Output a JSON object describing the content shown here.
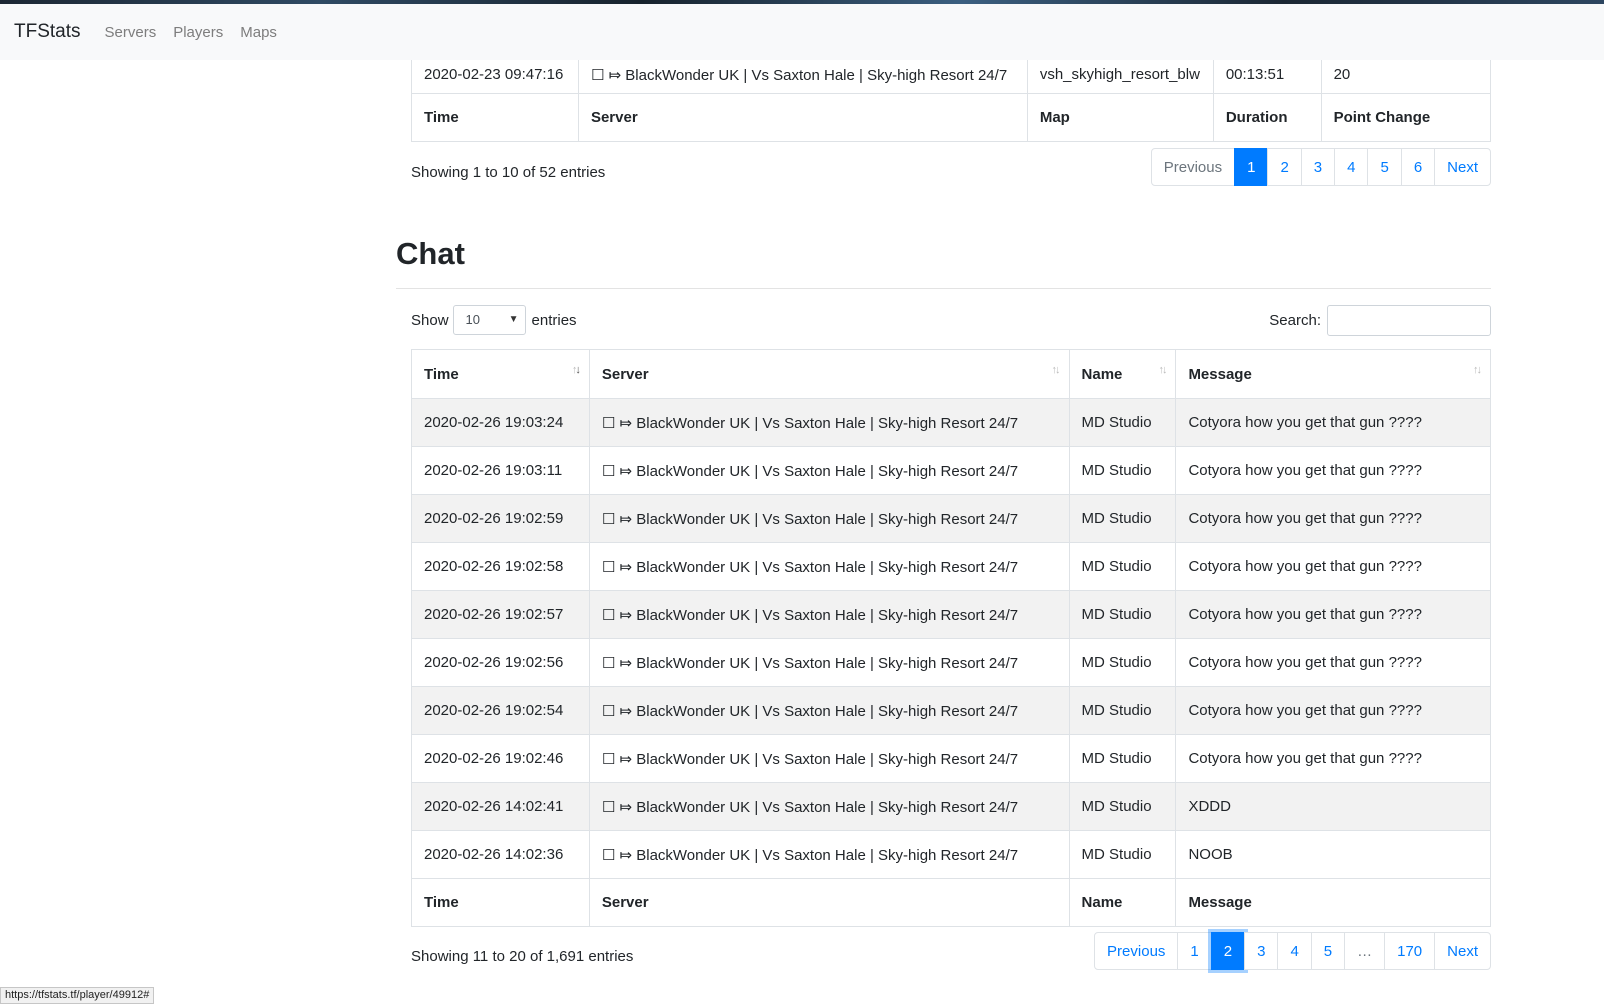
{
  "navbar": {
    "brand": "TFStats",
    "links": [
      "Servers",
      "Players",
      "Maps"
    ]
  },
  "sessions": {
    "last_row": {
      "time": "2020-02-23 09:47:16",
      "server": "☐ ⤇ BlackWonder UK | Vs Saxton Hale | Sky-high Resort 24/7",
      "map": "vsh_skyhigh_resort_blw",
      "duration": "00:13:51",
      "points": "20"
    },
    "footer_headers": [
      "Time",
      "Server",
      "Map",
      "Duration",
      "Point Change"
    ],
    "info": "Showing 1 to 10 of 52 entries",
    "pagination": [
      "Previous",
      "1",
      "2",
      "3",
      "4",
      "5",
      "6",
      "Next"
    ],
    "active_page": "1"
  },
  "chat": {
    "title": "Chat",
    "length_label_before": "Show",
    "length_value": "10",
    "length_label_after": "entries",
    "search_label": "Search:",
    "search_value": "",
    "headers": [
      "Time",
      "Server",
      "Name",
      "Message"
    ],
    "rows": [
      {
        "time": "2020-02-26 19:03:24",
        "server": "☐ ⤇ BlackWonder UK | Vs Saxton Hale | Sky-high Resort 24/7",
        "name": "MD Studio",
        "message": "Cotyora how you get that gun ????"
      },
      {
        "time": "2020-02-26 19:03:11",
        "server": "☐ ⤇ BlackWonder UK | Vs Saxton Hale | Sky-high Resort 24/7",
        "name": "MD Studio",
        "message": "Cotyora how you get that gun ????"
      },
      {
        "time": "2020-02-26 19:02:59",
        "server": "☐ ⤇ BlackWonder UK | Vs Saxton Hale | Sky-high Resort 24/7",
        "name": "MD Studio",
        "message": "Cotyora how you get that gun ????"
      },
      {
        "time": "2020-02-26 19:02:58",
        "server": "☐ ⤇ BlackWonder UK | Vs Saxton Hale | Sky-high Resort 24/7",
        "name": "MD Studio",
        "message": "Cotyora how you get that gun ????"
      },
      {
        "time": "2020-02-26 19:02:57",
        "server": "☐ ⤇ BlackWonder UK | Vs Saxton Hale | Sky-high Resort 24/7",
        "name": "MD Studio",
        "message": "Cotyora how you get that gun ????"
      },
      {
        "time": "2020-02-26 19:02:56",
        "server": "☐ ⤇ BlackWonder UK | Vs Saxton Hale | Sky-high Resort 24/7",
        "name": "MD Studio",
        "message": "Cotyora how you get that gun ????"
      },
      {
        "time": "2020-02-26 19:02:54",
        "server": "☐ ⤇ BlackWonder UK | Vs Saxton Hale | Sky-high Resort 24/7",
        "name": "MD Studio",
        "message": "Cotyora how you get that gun ????"
      },
      {
        "time": "2020-02-26 19:02:46",
        "server": "☐ ⤇ BlackWonder UK | Vs Saxton Hale | Sky-high Resort 24/7",
        "name": "MD Studio",
        "message": "Cotyora how you get that gun ????"
      },
      {
        "time": "2020-02-26 14:02:41",
        "server": "☐ ⤇ BlackWonder UK | Vs Saxton Hale | Sky-high Resort 24/7",
        "name": "MD Studio",
        "message": "XDDD"
      },
      {
        "time": "2020-02-26 14:02:36",
        "server": "☐ ⤇ BlackWonder UK | Vs Saxton Hale | Sky-high Resort 24/7",
        "name": "MD Studio",
        "message": "NOOB"
      }
    ],
    "info": "Showing 11 to 20 of 1,691 entries",
    "pagination": [
      "Previous",
      "1",
      "2",
      "3",
      "4",
      "5",
      "…",
      "170",
      "Next"
    ],
    "active_page": "2"
  },
  "statusbar": "https://tfstats.tf/player/49912#",
  "colors": {
    "accent": "#007bff",
    "stripe": "#f2f2f2",
    "navbar": "#f8f9fa"
  }
}
